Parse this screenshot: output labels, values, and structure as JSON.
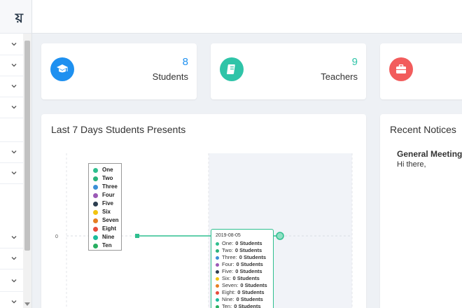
{
  "brand": {
    "text": "য়"
  },
  "cards": [
    {
      "value": "8",
      "label": "Students",
      "icon": "graduation-cap-icon",
      "color": "#1e90f0",
      "value_color": "#1e90f0"
    },
    {
      "value": "9",
      "label": "Teachers",
      "icon": "book-icon",
      "color": "#2fc4a8",
      "value_color": "#2fc4a8"
    },
    {
      "value": "",
      "label": "",
      "icon": "briefcase-icon",
      "color": "#f25c5c",
      "value_color": "#f25c5c"
    }
  ],
  "chart": {
    "title": "Last 7 Days Students Presents",
    "y_tick": "0",
    "tooltip_date": "2019-08-05"
  },
  "chart_data": {
    "type": "line",
    "title": "Last 7 Days Students Presents",
    "x": [
      "2019-08-05"
    ],
    "ylabel": "",
    "series": [
      {
        "name": "One",
        "color": "#2fbf8f",
        "values": [
          0
        ]
      },
      {
        "name": "Two",
        "color": "#2ab27b",
        "values": [
          0
        ]
      },
      {
        "name": "Three",
        "color": "#3b8fd6",
        "values": [
          0
        ]
      },
      {
        "name": "Four",
        "color": "#9b59b6",
        "values": [
          0
        ]
      },
      {
        "name": "Five",
        "color": "#2c3e50",
        "values": [
          0
        ]
      },
      {
        "name": "Six",
        "color": "#f1c40f",
        "values": [
          0
        ]
      },
      {
        "name": "Seven",
        "color": "#e67e22",
        "values": [
          0
        ]
      },
      {
        "name": "Eight",
        "color": "#e74c3c",
        "values": [
          0
        ]
      },
      {
        "name": "Nine",
        "color": "#1abc9c",
        "values": [
          0
        ]
      },
      {
        "name": "Ten",
        "color": "#27ae60",
        "values": [
          0
        ]
      }
    ],
    "unit_label": "Students",
    "legend": "top-left"
  },
  "notices": {
    "title": "Recent Notices",
    "items": [
      {
        "title": "General Meeting",
        "body": "Hi there,"
      }
    ]
  }
}
